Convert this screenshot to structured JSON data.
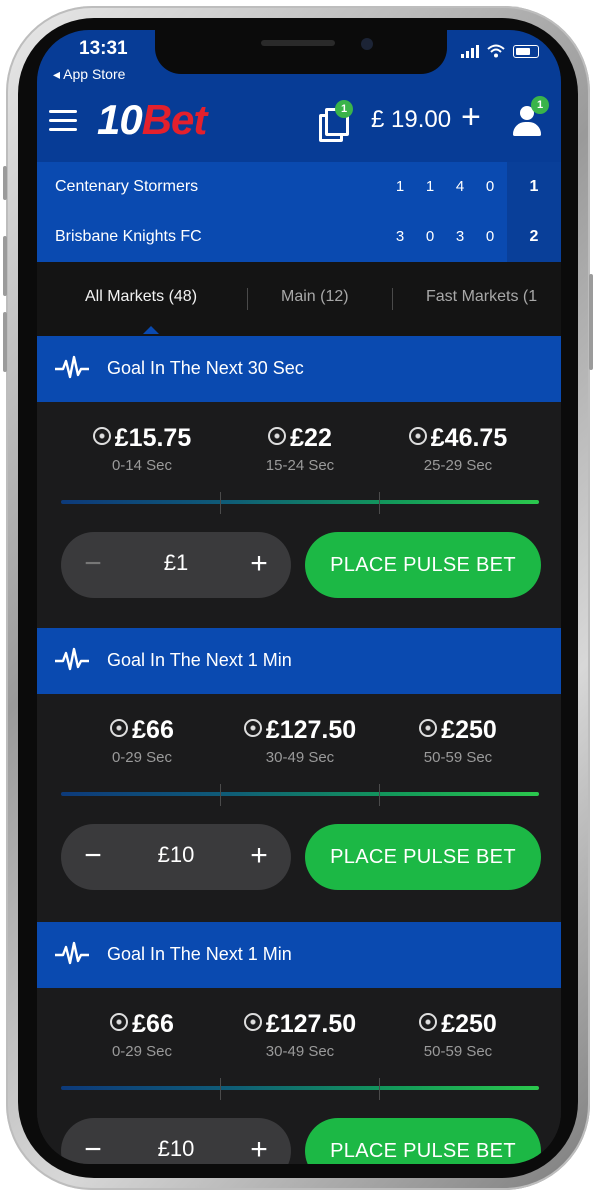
{
  "status": {
    "time": "13:31",
    "back_label": "◂ App Store"
  },
  "header": {
    "logo_num": "10",
    "logo_word": "Bet",
    "betslip_count": "1",
    "balance": "£ 19.00",
    "add_funds": "+",
    "account_badge": "1"
  },
  "scoreboard": [
    {
      "team": "Centenary Stormers",
      "scores": [
        "1",
        "1",
        "4",
        "0"
      ],
      "total": "1"
    },
    {
      "team": "Brisbane Knights FC",
      "scores": [
        "3",
        "0",
        "3",
        "0"
      ],
      "total": "2"
    }
  ],
  "tabs": [
    {
      "label": "All Markets (48)"
    },
    {
      "label": "Main (12)"
    },
    {
      "label": "Fast Markets (1"
    }
  ],
  "markets": [
    {
      "title": "Goal In The Next 30 Sec",
      "odds": [
        {
          "price": "£15.75",
          "range": "0-14 Sec"
        },
        {
          "price": "£22",
          "range": "15-24 Sec"
        },
        {
          "price": "£46.75",
          "range": "25-29 Sec"
        }
      ],
      "stake": "£1",
      "minus": "−",
      "plus": "+",
      "cta": "PLACE PULSE BET"
    },
    {
      "title": "Goal In The Next 1 Min",
      "odds": [
        {
          "price": "£66",
          "range": "0-29 Sec"
        },
        {
          "price": "£127.50",
          "range": "30-49 Sec"
        },
        {
          "price": "£250",
          "range": "50-59 Sec"
        }
      ],
      "stake": "£10",
      "minus": "−",
      "plus": "+",
      "cta": "PLACE PULSE BET"
    },
    {
      "title": "Goal In The Next 1 Min",
      "odds": [
        {
          "price": "£66",
          "range": "0-29 Sec"
        },
        {
          "price": "£127.50",
          "range": "30-49 Sec"
        },
        {
          "price": "£250",
          "range": "50-59 Sec"
        }
      ],
      "stake": "£10",
      "minus": "−",
      "plus": "+",
      "cta": "PLACE PULSE BET"
    }
  ],
  "colors": {
    "brand_blue": "#0a4ab0",
    "header_blue": "#073c96",
    "logo_red": "#e4202c",
    "cta_green": "#1cb845",
    "badge_green": "#3ab44a",
    "panel_dark": "#1b1b1c"
  },
  "icons": [
    "menu-icon",
    "betslip-icon",
    "plus-icon",
    "user-icon",
    "pulse-icon",
    "football-icon",
    "signal-icon",
    "wifi-icon",
    "battery-icon"
  ]
}
